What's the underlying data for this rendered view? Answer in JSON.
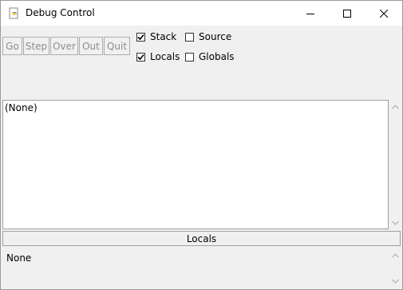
{
  "window": {
    "title": "Debug Control"
  },
  "toolbar": {
    "go_label": "Go",
    "step_label": "Step",
    "over_label": "Over",
    "out_label": "Out",
    "quit_label": "Quit"
  },
  "options": {
    "stack": {
      "label": "Stack",
      "checked": true
    },
    "source": {
      "label": "Source",
      "checked": false
    },
    "locals": {
      "label": "Locals",
      "checked": true
    },
    "globals": {
      "label": "Globals",
      "checked": false
    }
  },
  "stack_pane": {
    "text": "(None)"
  },
  "locals_section": {
    "header": "Locals",
    "value": "None"
  }
}
